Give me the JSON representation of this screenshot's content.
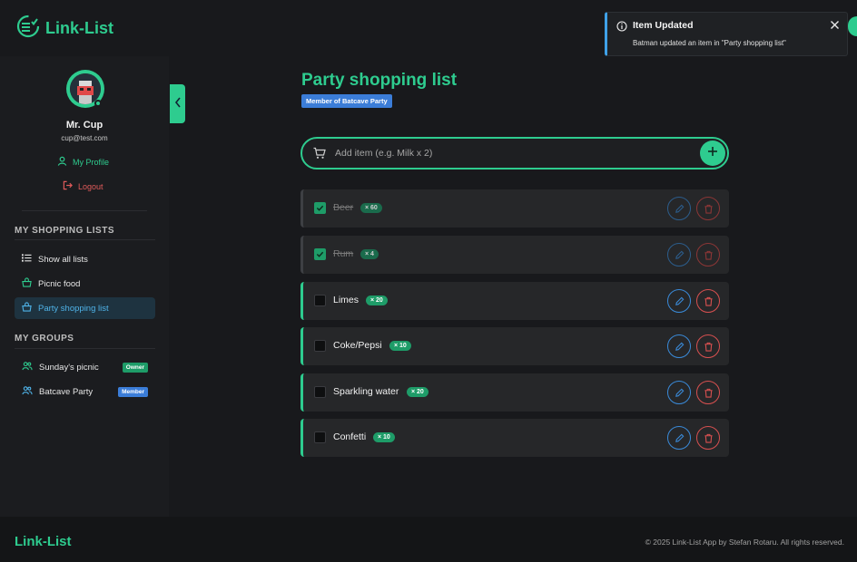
{
  "header": {
    "logo_text": "Link-List",
    "logo_icon": "list-check-icon"
  },
  "sidebar": {
    "user": {
      "name": "Mr. Cup",
      "email": "cup@test.com"
    },
    "profile_label": "My Profile",
    "logout_label": "Logout",
    "shopping_lists_title": "MY SHOPPING LISTS",
    "lists": [
      {
        "label": "Show all lists",
        "icon": "list-icon",
        "active": false
      },
      {
        "label": "Picnic food",
        "icon": "basket-icon",
        "active": false
      },
      {
        "label": "Party shopping list",
        "icon": "basket-icon",
        "active": true
      }
    ],
    "groups_title": "MY GROUPS",
    "groups": [
      {
        "label": "Sunday's picnic",
        "badge": "Owner",
        "icon": "users-icon"
      },
      {
        "label": "Batcave Party",
        "badge": "Member",
        "icon": "users-icon"
      }
    ]
  },
  "main": {
    "title": "Party shopping list",
    "membership_tag": "Member of Batcave Party",
    "add_placeholder": "Add item (e.g. Milk x 2)",
    "items": [
      {
        "name": "Beer",
        "qty": "× 60",
        "done": true
      },
      {
        "name": "Rum",
        "qty": "× 4",
        "done": true
      },
      {
        "name": "Limes",
        "qty": "× 20",
        "done": false
      },
      {
        "name": "Coke/Pepsi",
        "qty": "× 10",
        "done": false
      },
      {
        "name": "Sparkling water",
        "qty": "× 20",
        "done": false
      },
      {
        "name": "Confetti",
        "qty": "× 10",
        "done": false
      }
    ]
  },
  "toast": {
    "title": "Item Updated",
    "message": "Batman updated an item in \"Party shopping list\""
  },
  "footer": {
    "logo_text": "Link-List",
    "copyright": "© 2025 Link-List App by Stefan Rotaru. All rights reserved."
  },
  "colors": {
    "accent": "#2ecc8f",
    "danger": "#d85050",
    "info": "#3fa1e8",
    "member_badge": "#3b7dd8"
  }
}
